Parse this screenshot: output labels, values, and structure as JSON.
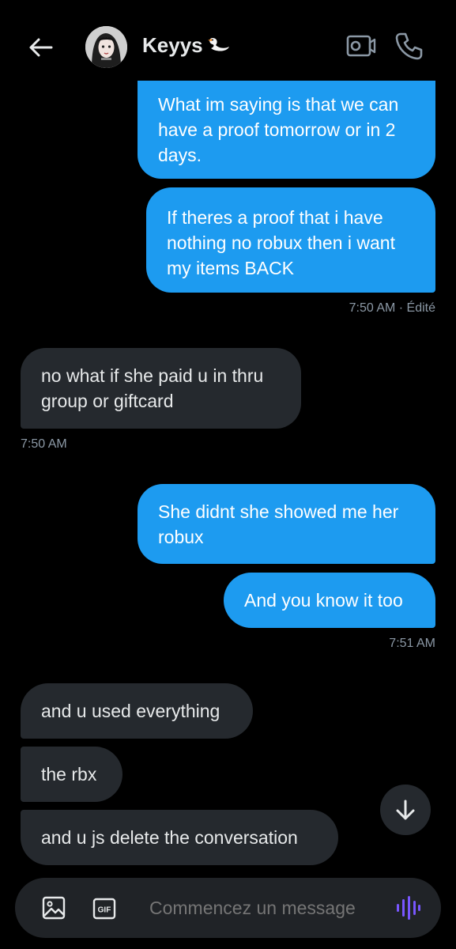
{
  "header": {
    "contact_name": "Keyys",
    "back_icon": "arrow-left-icon",
    "video_icon": "video-call-icon",
    "call_icon": "phone-icon"
  },
  "messages": [
    {
      "dir": "out",
      "text": "What im saying is that we can\nhave a proof tomorrow or in 2\ndays."
    },
    {
      "dir": "out",
      "text": "If theres a proof that i have\nnothing no robux then i want\nmy items BACK"
    },
    {
      "dir": "in",
      "text": "no what if she paid u in thru\ngroup or giftcard"
    },
    {
      "dir": "out",
      "text": "She didnt she showed me her\nrobux"
    },
    {
      "dir": "out",
      "text": "And you know it too"
    },
    {
      "dir": "in",
      "text": "and u used everything"
    },
    {
      "dir": "in",
      "text": "the rbx"
    },
    {
      "dir": "in",
      "text": "and u js delete the conversation"
    }
  ],
  "timestamps": {
    "t1": "7:50 AM · Édité",
    "t2": "7:50 AM",
    "t3": "7:51 AM"
  },
  "composer": {
    "placeholder": "Commencez un message",
    "gif_label": "GIF"
  },
  "colors": {
    "outgoing_bubble": "#1d9bf0",
    "incoming_bubble": "#25292e",
    "voice_accent": "#7856ff",
    "background": "#000000"
  }
}
